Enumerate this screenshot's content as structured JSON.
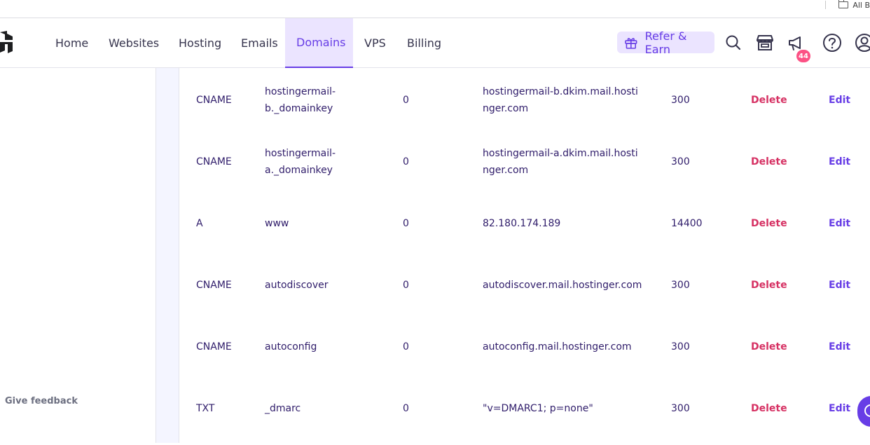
{
  "browser": {
    "bookmarks_label": "All B"
  },
  "nav": {
    "items": [
      {
        "label": "Home"
      },
      {
        "label": "Websites"
      },
      {
        "label": "Hosting"
      },
      {
        "label": "Emails"
      },
      {
        "label": "Domains",
        "active": true
      },
      {
        "label": "VPS"
      },
      {
        "label": "Billing"
      }
    ],
    "refer_label": "Refer & Earn",
    "notification_count": "44",
    "icons": [
      "search-icon",
      "store-icon",
      "megaphone-icon",
      "help-icon",
      "account-icon"
    ]
  },
  "sidebar": {
    "feedback_label": "Give feedback"
  },
  "records": [
    {
      "type": "CNAME",
      "name": "hostingermail-b._domainkey",
      "priority": "0",
      "content": "hostingermail-b.dkim.mail.hostinger.com",
      "ttl": "300",
      "delete": "Delete",
      "edit": "Edit"
    },
    {
      "type": "CNAME",
      "name": "hostingermail-a._domainkey",
      "priority": "0",
      "content": "hostingermail-a.dkim.mail.hostinger.com",
      "ttl": "300",
      "delete": "Delete",
      "edit": "Edit"
    },
    {
      "type": "A",
      "name": "www",
      "priority": "0",
      "content": "82.180.174.189",
      "ttl": "14400",
      "delete": "Delete",
      "edit": "Edit"
    },
    {
      "type": "CNAME",
      "name": "autodiscover",
      "priority": "0",
      "content": "autodiscover.mail.hostinger.com",
      "ttl": "300",
      "delete": "Delete",
      "edit": "Edit"
    },
    {
      "type": "CNAME",
      "name": "autoconfig",
      "priority": "0",
      "content": "autoconfig.mail.hostinger.com",
      "ttl": "300",
      "delete": "Delete",
      "edit": "Edit"
    },
    {
      "type": "TXT",
      "name": "_dmarc",
      "priority": "0",
      "content": "\"v=DMARC1; p=none\"",
      "ttl": "300",
      "delete": "Delete",
      "edit": "Edit"
    }
  ],
  "colors": {
    "accent": "#673de6",
    "accent_light": "#ebe4ff",
    "danger": "#d63163",
    "text": "#2f1c6a",
    "badge": "#fc5185"
  }
}
